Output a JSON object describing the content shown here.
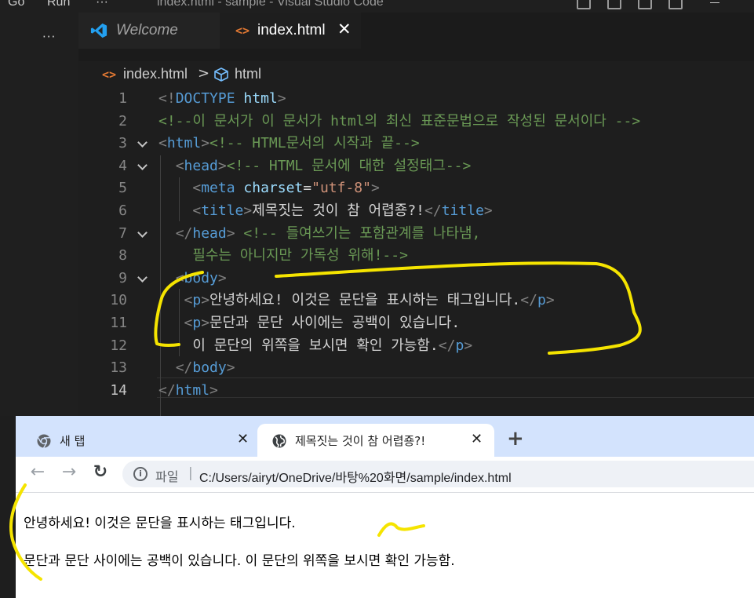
{
  "titlebar": {
    "menu_go": "Go",
    "menu_run": "Run",
    "menu_more": "···",
    "window_title": "index.html - sample - Visual Studio Code"
  },
  "activity": {
    "more": "···"
  },
  "tabs": {
    "welcome": "Welcome",
    "index": "index.html",
    "html_icon": "<>",
    "close": "✕"
  },
  "breadcrumb": {
    "file": "index.html",
    "separator": ">",
    "element": "html"
  },
  "editor": {
    "lines": [
      {
        "n": "1",
        "tokens": [
          [
            "t-br",
            "<!"
          ],
          [
            "t-name",
            "DOCTYPE"
          ],
          [
            "t-txt",
            " "
          ],
          [
            "t-attr",
            "html"
          ],
          [
            "t-br",
            ">"
          ]
        ]
      },
      {
        "n": "2",
        "tokens": [
          [
            "t-com",
            "<!--이 문서가 이 문서가 html의 최신 표준문법으로 작성된 문서이다 -->"
          ]
        ]
      },
      {
        "n": "3",
        "tokens": [
          [
            "t-br",
            "<"
          ],
          [
            "t-tag",
            "html"
          ],
          [
            "t-br",
            ">"
          ],
          [
            "t-com",
            "<!-- HTML문서의 시작과 끝-->"
          ]
        ]
      },
      {
        "n": "4",
        "tokens": [
          [
            "t-txt",
            "  "
          ],
          [
            "t-br",
            "<"
          ],
          [
            "t-tag",
            "head"
          ],
          [
            "t-br",
            ">"
          ],
          [
            "t-com",
            "<!-- HTML 문서에 대한 설정태그-->"
          ]
        ]
      },
      {
        "n": "5",
        "tokens": [
          [
            "t-txt",
            "    "
          ],
          [
            "t-br",
            "<"
          ],
          [
            "t-tag",
            "meta"
          ],
          [
            "t-txt",
            " "
          ],
          [
            "t-attr",
            "charset"
          ],
          [
            "t-txt",
            "="
          ],
          [
            "t-str",
            "\"utf-8\""
          ],
          [
            "t-br",
            ">"
          ]
        ]
      },
      {
        "n": "6",
        "tokens": [
          [
            "t-txt",
            "    "
          ],
          [
            "t-br",
            "<"
          ],
          [
            "t-tag",
            "title"
          ],
          [
            "t-br",
            ">"
          ],
          [
            "t-txt",
            "제목짓는 것이 참 어렵죵?!"
          ],
          [
            "t-br",
            "</"
          ],
          [
            "t-tag",
            "title"
          ],
          [
            "t-br",
            ">"
          ]
        ]
      },
      {
        "n": "7",
        "tokens": [
          [
            "t-txt",
            "  "
          ],
          [
            "t-br",
            "</"
          ],
          [
            "t-tag",
            "head"
          ],
          [
            "t-br",
            ">"
          ],
          [
            "t-txt",
            " "
          ],
          [
            "t-com",
            "<!-- 들여쓰기는 포함관계를 나타냄,"
          ]
        ]
      },
      {
        "n": "8",
        "tokens": [
          [
            "t-com",
            "    필수는 아니지만 가독성 위해!-->"
          ]
        ]
      },
      {
        "n": "9",
        "tokens": [
          [
            "t-txt",
            "  "
          ],
          [
            "t-br",
            "<"
          ],
          [
            "t-tag",
            "body"
          ],
          [
            "t-br",
            ">"
          ]
        ]
      },
      {
        "n": "10",
        "tokens": [
          [
            "t-txt",
            "   "
          ],
          [
            "t-br",
            "<"
          ],
          [
            "t-tag",
            "p"
          ],
          [
            "t-br",
            ">"
          ],
          [
            "t-txt",
            "안녕하세요! 이것은 문단을 표시하는 태그입니다."
          ],
          [
            "t-br",
            "</"
          ],
          [
            "t-tag",
            "p"
          ],
          [
            "t-br",
            ">"
          ]
        ]
      },
      {
        "n": "11",
        "tokens": [
          [
            "t-txt",
            "   "
          ],
          [
            "t-br",
            "<"
          ],
          [
            "t-tag",
            "p"
          ],
          [
            "t-br",
            ">"
          ],
          [
            "t-txt",
            "문단과 문단 사이에는 공백이 있습니다."
          ]
        ]
      },
      {
        "n": "12",
        "tokens": [
          [
            "t-txt",
            "    이 문단의 위쪽을 보시면 확인 가능함."
          ],
          [
            "t-br",
            "</"
          ],
          [
            "t-tag",
            "p"
          ],
          [
            "t-br",
            ">"
          ]
        ]
      },
      {
        "n": "13",
        "tokens": [
          [
            "t-txt",
            "  "
          ],
          [
            "t-br",
            "</"
          ],
          [
            "t-tag",
            "body"
          ],
          [
            "t-br",
            ">"
          ]
        ]
      },
      {
        "n": "14",
        "tokens": [
          [
            "t-br",
            "</"
          ],
          [
            "t-tag",
            "html"
          ],
          [
            "t-br",
            ">"
          ]
        ]
      }
    ]
  },
  "chrome": {
    "tab_new": "새 탭",
    "tab_active": "제목짓는 것이 참 어렵죵?!",
    "close": "✕",
    "add": "+",
    "back": "←",
    "forward": "→",
    "reload": "↻",
    "info": "i",
    "omni_label": "파일",
    "omni_sep": "|",
    "url": "C:/Users/airyt/OneDrive/바탕%20화면/sample/index.html"
  },
  "page": {
    "para1": "안녕하세요! 이것은 문단을 표시하는 태그입니다.",
    "para2": "문단과 문단 사이에는 공백이 있습니다. 이 문단의 위쪽을 보시면 확인 가능함."
  },
  "colors": {
    "annotation": "#f5e400",
    "editor_bg": "#1e1e1e",
    "chrome_tabstrip": "#d3e3fd"
  }
}
